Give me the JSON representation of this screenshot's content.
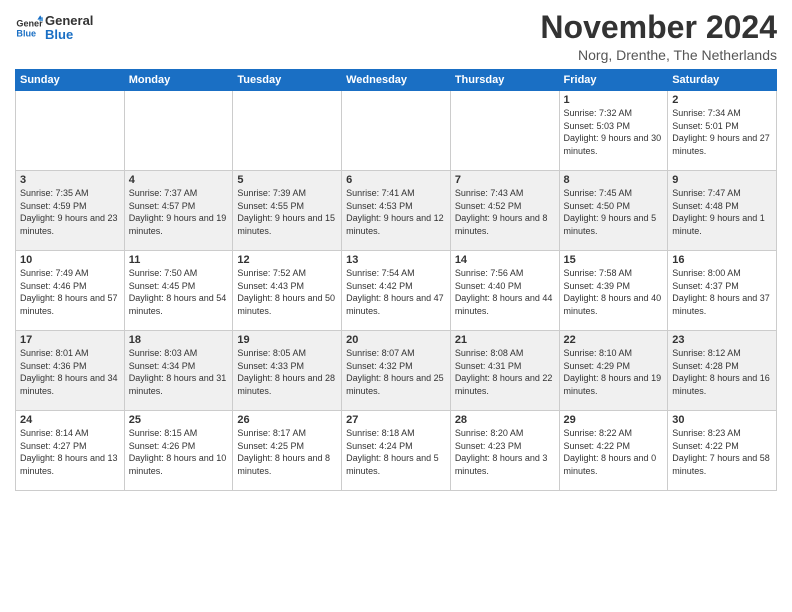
{
  "logo": {
    "text_general": "General",
    "text_blue": "Blue"
  },
  "title": "November 2024",
  "location": "Norg, Drenthe, The Netherlands",
  "days_of_week": [
    "Sunday",
    "Monday",
    "Tuesday",
    "Wednesday",
    "Thursday",
    "Friday",
    "Saturday"
  ],
  "weeks": [
    [
      {
        "day": "",
        "info": ""
      },
      {
        "day": "",
        "info": ""
      },
      {
        "day": "",
        "info": ""
      },
      {
        "day": "",
        "info": ""
      },
      {
        "day": "",
        "info": ""
      },
      {
        "day": "1",
        "info": "Sunrise: 7:32 AM\nSunset: 5:03 PM\nDaylight: 9 hours and 30 minutes."
      },
      {
        "day": "2",
        "info": "Sunrise: 7:34 AM\nSunset: 5:01 PM\nDaylight: 9 hours and 27 minutes."
      }
    ],
    [
      {
        "day": "3",
        "info": "Sunrise: 7:35 AM\nSunset: 4:59 PM\nDaylight: 9 hours and 23 minutes."
      },
      {
        "day": "4",
        "info": "Sunrise: 7:37 AM\nSunset: 4:57 PM\nDaylight: 9 hours and 19 minutes."
      },
      {
        "day": "5",
        "info": "Sunrise: 7:39 AM\nSunset: 4:55 PM\nDaylight: 9 hours and 15 minutes."
      },
      {
        "day": "6",
        "info": "Sunrise: 7:41 AM\nSunset: 4:53 PM\nDaylight: 9 hours and 12 minutes."
      },
      {
        "day": "7",
        "info": "Sunrise: 7:43 AM\nSunset: 4:52 PM\nDaylight: 9 hours and 8 minutes."
      },
      {
        "day": "8",
        "info": "Sunrise: 7:45 AM\nSunset: 4:50 PM\nDaylight: 9 hours and 5 minutes."
      },
      {
        "day": "9",
        "info": "Sunrise: 7:47 AM\nSunset: 4:48 PM\nDaylight: 9 hours and 1 minute."
      }
    ],
    [
      {
        "day": "10",
        "info": "Sunrise: 7:49 AM\nSunset: 4:46 PM\nDaylight: 8 hours and 57 minutes."
      },
      {
        "day": "11",
        "info": "Sunrise: 7:50 AM\nSunset: 4:45 PM\nDaylight: 8 hours and 54 minutes."
      },
      {
        "day": "12",
        "info": "Sunrise: 7:52 AM\nSunset: 4:43 PM\nDaylight: 8 hours and 50 minutes."
      },
      {
        "day": "13",
        "info": "Sunrise: 7:54 AM\nSunset: 4:42 PM\nDaylight: 8 hours and 47 minutes."
      },
      {
        "day": "14",
        "info": "Sunrise: 7:56 AM\nSunset: 4:40 PM\nDaylight: 8 hours and 44 minutes."
      },
      {
        "day": "15",
        "info": "Sunrise: 7:58 AM\nSunset: 4:39 PM\nDaylight: 8 hours and 40 minutes."
      },
      {
        "day": "16",
        "info": "Sunrise: 8:00 AM\nSunset: 4:37 PM\nDaylight: 8 hours and 37 minutes."
      }
    ],
    [
      {
        "day": "17",
        "info": "Sunrise: 8:01 AM\nSunset: 4:36 PM\nDaylight: 8 hours and 34 minutes."
      },
      {
        "day": "18",
        "info": "Sunrise: 8:03 AM\nSunset: 4:34 PM\nDaylight: 8 hours and 31 minutes."
      },
      {
        "day": "19",
        "info": "Sunrise: 8:05 AM\nSunset: 4:33 PM\nDaylight: 8 hours and 28 minutes."
      },
      {
        "day": "20",
        "info": "Sunrise: 8:07 AM\nSunset: 4:32 PM\nDaylight: 8 hours and 25 minutes."
      },
      {
        "day": "21",
        "info": "Sunrise: 8:08 AM\nSunset: 4:31 PM\nDaylight: 8 hours and 22 minutes."
      },
      {
        "day": "22",
        "info": "Sunrise: 8:10 AM\nSunset: 4:29 PM\nDaylight: 8 hours and 19 minutes."
      },
      {
        "day": "23",
        "info": "Sunrise: 8:12 AM\nSunset: 4:28 PM\nDaylight: 8 hours and 16 minutes."
      }
    ],
    [
      {
        "day": "24",
        "info": "Sunrise: 8:14 AM\nSunset: 4:27 PM\nDaylight: 8 hours and 13 minutes."
      },
      {
        "day": "25",
        "info": "Sunrise: 8:15 AM\nSunset: 4:26 PM\nDaylight: 8 hours and 10 minutes."
      },
      {
        "day": "26",
        "info": "Sunrise: 8:17 AM\nSunset: 4:25 PM\nDaylight: 8 hours and 8 minutes."
      },
      {
        "day": "27",
        "info": "Sunrise: 8:18 AM\nSunset: 4:24 PM\nDaylight: 8 hours and 5 minutes."
      },
      {
        "day": "28",
        "info": "Sunrise: 8:20 AM\nSunset: 4:23 PM\nDaylight: 8 hours and 3 minutes."
      },
      {
        "day": "29",
        "info": "Sunrise: 8:22 AM\nSunset: 4:22 PM\nDaylight: 8 hours and 0 minutes."
      },
      {
        "day": "30",
        "info": "Sunrise: 8:23 AM\nSunset: 4:22 PM\nDaylight: 7 hours and 58 minutes."
      }
    ]
  ]
}
